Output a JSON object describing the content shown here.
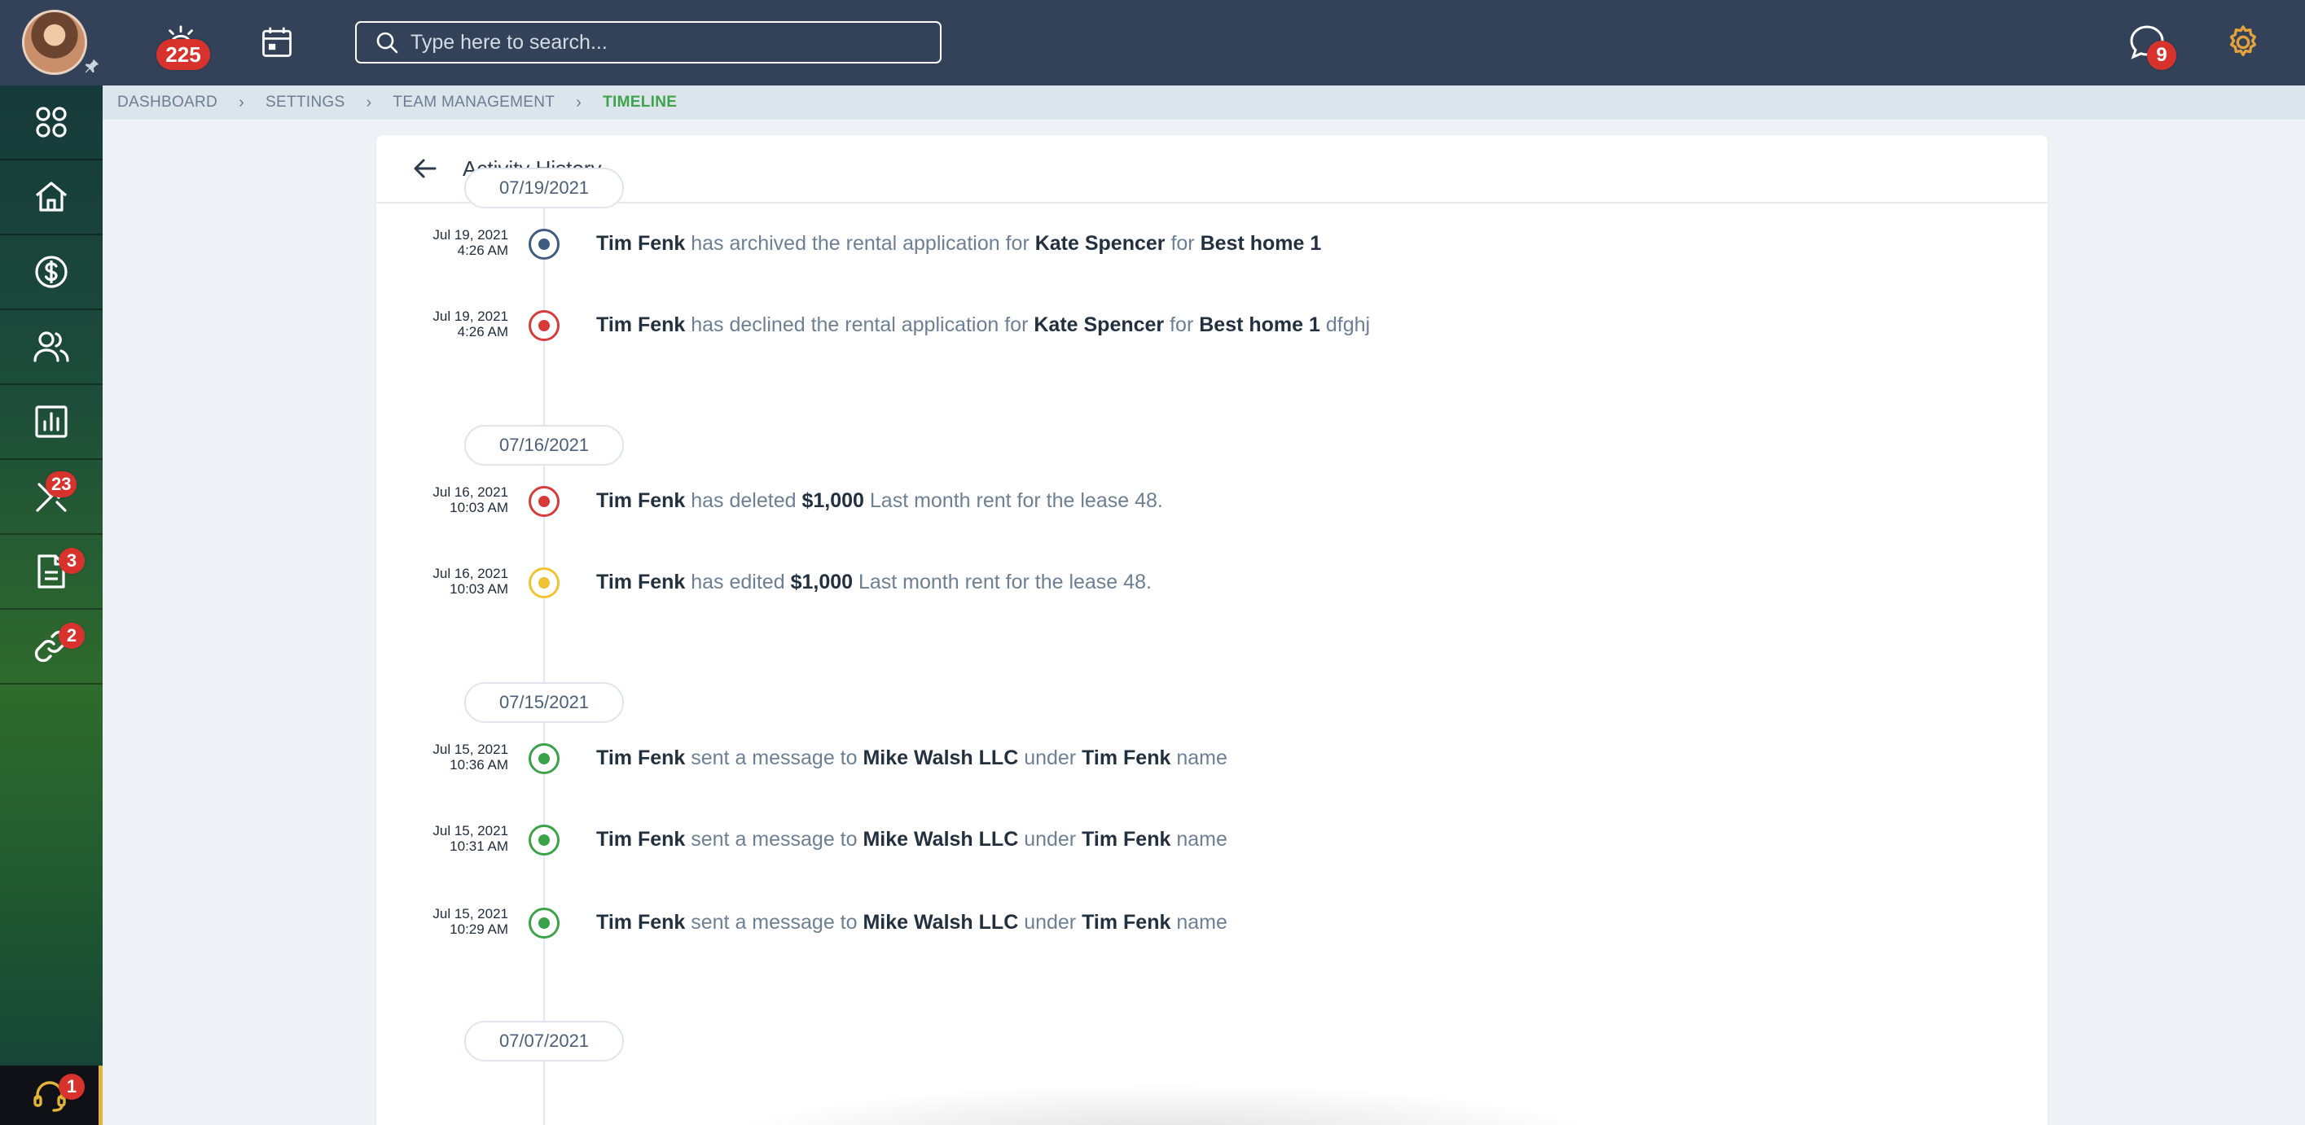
{
  "topbar": {
    "notifications_count": "225",
    "search_placeholder": "Type here to search...",
    "messages_count": "9",
    "accent": "#e3a33a"
  },
  "sidebar": {
    "items": [
      {
        "name": "apps",
        "icon": "grid-icon",
        "badge": ""
      },
      {
        "name": "home",
        "icon": "home-icon",
        "badge": ""
      },
      {
        "name": "finance",
        "icon": "dollar-icon",
        "badge": ""
      },
      {
        "name": "people",
        "icon": "users-icon",
        "badge": ""
      },
      {
        "name": "reports",
        "icon": "chart-icon",
        "badge": ""
      },
      {
        "name": "maintenance",
        "icon": "tools-icon",
        "badge": "23"
      },
      {
        "name": "documents",
        "icon": "document-icon",
        "badge": "3"
      },
      {
        "name": "links",
        "icon": "link-icon",
        "badge": "2"
      }
    ],
    "support_badge": "1"
  },
  "breadcrumb": {
    "items": [
      "DASHBOARD",
      "SETTINGS",
      "TEAM MANAGEMENT",
      "TIMELINE"
    ]
  },
  "page": {
    "title": "Activity History"
  },
  "timeline": {
    "groups": [
      {
        "date": "07/19/2021",
        "entries": [
          {
            "date": "Jul 19, 2021",
            "time": "4:26 AM",
            "color": "blue",
            "parts": [
              [
                "b",
                "Tim Fenk"
              ],
              [
                "t",
                " has archived the rental application for "
              ],
              [
                "b",
                "Kate Spencer"
              ],
              [
                "t",
                " for "
              ],
              [
                "b",
                "Best home 1"
              ]
            ]
          },
          {
            "date": "Jul 19, 2021",
            "time": "4:26 AM",
            "color": "red",
            "parts": [
              [
                "b",
                "Tim Fenk"
              ],
              [
                "t",
                " has declined the rental application for "
              ],
              [
                "b",
                "Kate Spencer"
              ],
              [
                "t",
                " for "
              ],
              [
                "b",
                "Best home 1"
              ],
              [
                "t",
                " dfghj"
              ]
            ]
          }
        ]
      },
      {
        "date": "07/16/2021",
        "entries": [
          {
            "date": "Jul 16, 2021",
            "time": "10:03 AM",
            "color": "red",
            "parts": [
              [
                "b",
                "Tim Fenk"
              ],
              [
                "t",
                " has deleted "
              ],
              [
                "b",
                "$1,000"
              ],
              [
                "t",
                " Last month rent for the lease 48."
              ]
            ]
          },
          {
            "date": "Jul 16, 2021",
            "time": "10:03 AM",
            "color": "yellow",
            "parts": [
              [
                "b",
                "Tim Fenk"
              ],
              [
                "t",
                " has edited "
              ],
              [
                "b",
                "$1,000"
              ],
              [
                "t",
                " Last month rent for the lease 48."
              ]
            ]
          }
        ]
      },
      {
        "date": "07/15/2021",
        "entries": [
          {
            "date": "Jul 15, 2021",
            "time": "10:36 AM",
            "color": "green",
            "parts": [
              [
                "b",
                "Tim Fenk"
              ],
              [
                "t",
                " sent a message to "
              ],
              [
                "b",
                "Mike Walsh LLC"
              ],
              [
                "t",
                " under "
              ],
              [
                "b",
                "Tim Fenk"
              ],
              [
                "t",
                " name"
              ]
            ]
          },
          {
            "date": "Jul 15, 2021",
            "time": "10:31 AM",
            "color": "green",
            "parts": [
              [
                "b",
                "Tim Fenk"
              ],
              [
                "t",
                " sent a message to "
              ],
              [
                "b",
                "Mike Walsh LLC"
              ],
              [
                "t",
                " under "
              ],
              [
                "b",
                "Tim Fenk"
              ],
              [
                "t",
                " name"
              ]
            ]
          },
          {
            "date": "Jul 15, 2021",
            "time": "10:29 AM",
            "color": "green",
            "parts": [
              [
                "b",
                "Tim Fenk"
              ],
              [
                "t",
                " sent a message to "
              ],
              [
                "b",
                "Mike Walsh LLC"
              ],
              [
                "t",
                " under "
              ],
              [
                "b",
                "Tim Fenk"
              ],
              [
                "t",
                " name"
              ]
            ]
          }
        ]
      },
      {
        "date": "07/07/2021",
        "entries": []
      }
    ]
  }
}
